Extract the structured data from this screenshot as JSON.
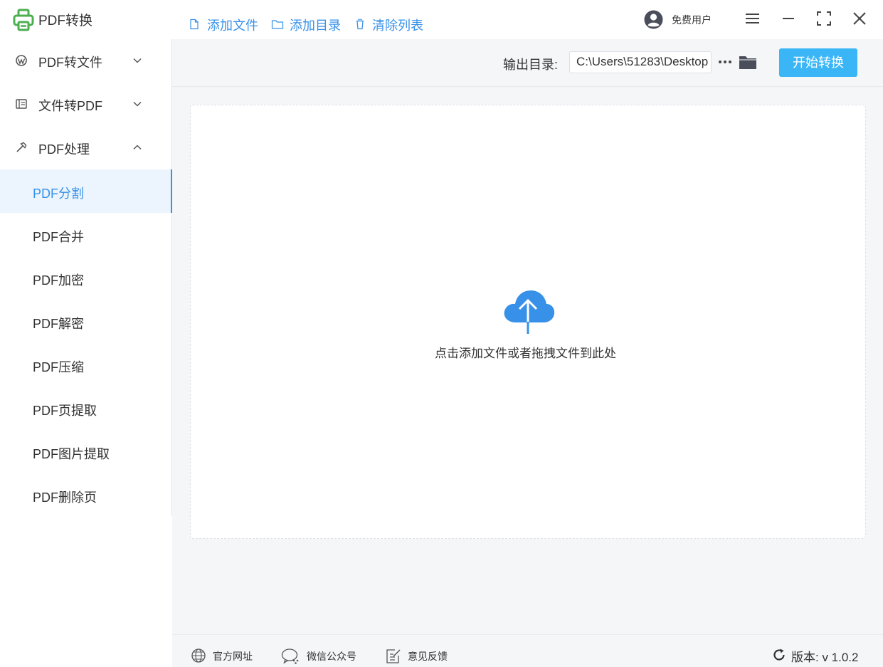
{
  "app": {
    "title": "PDF转换"
  },
  "user": {
    "label": "免费用户"
  },
  "sidebar": {
    "groups": [
      {
        "label": "PDF转文件",
        "icon": "wordpress-icon",
        "expanded": false
      },
      {
        "label": "文件转PDF",
        "icon": "document-icon",
        "expanded": false
      },
      {
        "label": "PDF处理",
        "icon": "hammer-icon",
        "expanded": true
      }
    ],
    "items": [
      {
        "label": "PDF分割",
        "active": true
      },
      {
        "label": "PDF合并",
        "active": false
      },
      {
        "label": "PDF加密",
        "active": false
      },
      {
        "label": "PDF解密",
        "active": false
      },
      {
        "label": "PDF压缩",
        "active": false
      },
      {
        "label": "PDF页提取",
        "active": false
      },
      {
        "label": "PDF图片提取",
        "active": false
      },
      {
        "label": "PDF删除页",
        "active": false
      }
    ]
  },
  "toolbar": {
    "add_file": "添加文件",
    "add_folder": "添加目录",
    "clear_list": "清除列表",
    "output_label": "输出目录:",
    "output_path": "C:\\Users\\51283\\Desktop",
    "start": "开始转换"
  },
  "dropzone": {
    "hint": "点击添加文件或者拖拽文件到此处"
  },
  "footer": {
    "website": "官方网址",
    "wechat": "微信公众号",
    "feedback": "意见反馈",
    "version": "版本: v 1.0.2"
  },
  "colors": {
    "accent": "#3891e8",
    "start_button": "#3ab6f7",
    "logo_green": "#4caf50",
    "active_bg": "#ecf5fe",
    "panel_bg": "#f5f6f8"
  }
}
